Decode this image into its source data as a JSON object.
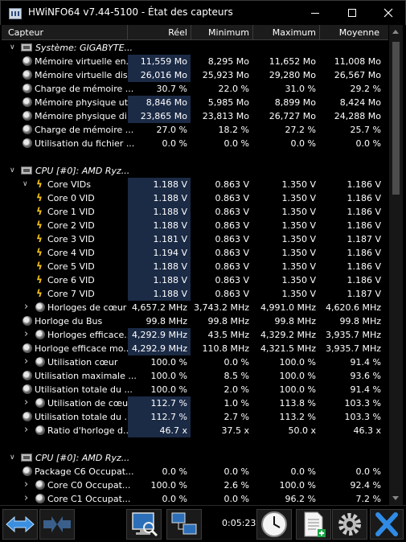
{
  "window": {
    "title": "HWiNFO64 v7.44-5100 - État des capteurs",
    "controls": {
      "minimize": "minimize-icon",
      "maximize": "maximize-icon",
      "close": "close-icon"
    }
  },
  "columns": {
    "sensor": "Capteur",
    "current": "Réel",
    "minimum": "Minimum",
    "maximum": "Maximum",
    "average": "Moyenne"
  },
  "rows": [
    {
      "type": "group",
      "label": "Système: GIGABYTE..."
    },
    {
      "type": "sensor",
      "label": "Mémoire virtuelle en...",
      "cur": "11,559 Mo",
      "min": "8,295 Mo",
      "max": "11,652 Mo",
      "avg": "11,008 Mo",
      "hl": true
    },
    {
      "type": "sensor",
      "label": "Mémoire virtuelle dis...",
      "cur": "26,016 Mo",
      "min": "25,923 Mo",
      "max": "29,280 Mo",
      "avg": "26,567 Mo",
      "hl": true
    },
    {
      "type": "sensor",
      "label": "Charge de mémoire ...",
      "cur": "30.7 %",
      "min": "22.0 %",
      "max": "31.0 %",
      "avg": "29.2 %",
      "hl": false
    },
    {
      "type": "sensor",
      "label": "Mémoire physique ut...",
      "cur": "8,846 Mo",
      "min": "5,985 Mo",
      "max": "8,899 Mo",
      "avg": "8,424 Mo",
      "hl": true
    },
    {
      "type": "sensor",
      "label": "Mémoire physique di...",
      "cur": "23,865 Mo",
      "min": "23,813 Mo",
      "max": "26,727 Mo",
      "avg": "24,288 Mo",
      "hl": true
    },
    {
      "type": "sensor",
      "label": "Charge de mémoire ...",
      "cur": "27.0 %",
      "min": "18.2 %",
      "max": "27.2 %",
      "avg": "25.7 %",
      "hl": false
    },
    {
      "type": "sensor",
      "label": "Utilisation du fichier ...",
      "cur": "0.0 %",
      "min": "0.0 %",
      "max": "0.0 %",
      "avg": "0.0 %",
      "hl": false
    },
    {
      "type": "blank"
    },
    {
      "type": "group",
      "label": "CPU [#0]: AMD Ryz..."
    },
    {
      "type": "volt-parent",
      "label": "Core VIDs",
      "cur": "1.188 V",
      "min": "0.863 V",
      "max": "1.350 V",
      "avg": "1.186 V",
      "hl": true
    },
    {
      "type": "volt",
      "label": "Core 0 VID",
      "cur": "1.188 V",
      "min": "0.863 V",
      "max": "1.350 V",
      "avg": "1.186 V",
      "hl": true
    },
    {
      "type": "volt",
      "label": "Core 1 VID",
      "cur": "1.188 V",
      "min": "0.863 V",
      "max": "1.350 V",
      "avg": "1.186 V",
      "hl": true
    },
    {
      "type": "volt",
      "label": "Core 2 VID",
      "cur": "1.188 V",
      "min": "0.863 V",
      "max": "1.350 V",
      "avg": "1.186 V",
      "hl": true
    },
    {
      "type": "volt",
      "label": "Core 3 VID",
      "cur": "1.181 V",
      "min": "0.863 V",
      "max": "1.350 V",
      "avg": "1.187 V",
      "hl": true
    },
    {
      "type": "volt",
      "label": "Core 4 VID",
      "cur": "1.194 V",
      "min": "0.863 V",
      "max": "1.350 V",
      "avg": "1.186 V",
      "hl": true
    },
    {
      "type": "volt",
      "label": "Core 5 VID",
      "cur": "1.188 V",
      "min": "0.863 V",
      "max": "1.350 V",
      "avg": "1.186 V",
      "hl": true
    },
    {
      "type": "volt",
      "label": "Core 6 VID",
      "cur": "1.188 V",
      "min": "0.863 V",
      "max": "1.350 V",
      "avg": "1.186 V",
      "hl": true
    },
    {
      "type": "volt",
      "label": "Core 7 VID",
      "cur": "1.188 V",
      "min": "0.863 V",
      "max": "1.350 V",
      "avg": "1.187 V",
      "hl": true
    },
    {
      "type": "clock-collapsed",
      "label": "Horloges de cœur",
      "cur": "4,657.2 MHz",
      "min": "3,743.2 MHz",
      "max": "4,991.0 MHz",
      "avg": "4,620.6 MHz",
      "hl": false
    },
    {
      "type": "clock",
      "label": "Horloge du Bus",
      "cur": "99.8 MHz",
      "min": "99.8 MHz",
      "max": "99.8 MHz",
      "avg": "99.8 MHz",
      "hl": false
    },
    {
      "type": "clock-collapsed",
      "label": "Horloges efficace...",
      "cur": "4,292.9 MHz",
      "min": "43.5 MHz",
      "max": "4,329.2 MHz",
      "avg": "3,935.7 MHz",
      "hl": true
    },
    {
      "type": "clock",
      "label": "Horloge efficace mo...",
      "cur": "4,292.9 MHz",
      "min": "110.8 MHz",
      "max": "4,321.5 MHz",
      "avg": "3,935.7 MHz",
      "hl": true
    },
    {
      "type": "sensor-collapsed",
      "label": "Utilisation cœur",
      "cur": "100.0 %",
      "min": "0.0 %",
      "max": "100.0 %",
      "avg": "91.4 %",
      "hl": false
    },
    {
      "type": "sensor",
      "label": "Utilisation maximale ...",
      "cur": "100.0 %",
      "min": "8.5 %",
      "max": "100.0 %",
      "avg": "93.6 %",
      "hl": false
    },
    {
      "type": "sensor",
      "label": "Utilisation totale du ...",
      "cur": "100.0 %",
      "min": "2.0 %",
      "max": "100.0 %",
      "avg": "91.4 %",
      "hl": false
    },
    {
      "type": "sensor-collapsed",
      "label": "Utilisation de cœur",
      "cur": "112.7 %",
      "min": "1.0 %",
      "max": "113.8 %",
      "avg": "103.3 %",
      "hl": true
    },
    {
      "type": "sensor",
      "label": "Utilisation totale du ...",
      "cur": "112.7 %",
      "min": "2.7 %",
      "max": "113.2 %",
      "avg": "103.3 %",
      "hl": true
    },
    {
      "type": "sensor-collapsed",
      "label": "Ratio d'horloge d...",
      "cur": "46.7 x",
      "min": "37.5 x",
      "max": "50.0 x",
      "avg": "46.3 x",
      "hl": true
    },
    {
      "type": "blank"
    },
    {
      "type": "group",
      "label": "CPU [#0]: AMD Ryz..."
    },
    {
      "type": "sensor",
      "label": "Package C6 Occupat...",
      "cur": "0.0 %",
      "min": "0.0 %",
      "max": "0.0 %",
      "avg": "0.0 %",
      "hl": false
    },
    {
      "type": "sensor-collapsed",
      "label": "Core C0 Occupat...",
      "cur": "100.0 %",
      "min": "2.6 %",
      "max": "100.0 %",
      "avg": "92.4 %",
      "hl": false
    },
    {
      "type": "sensor-collapsed",
      "label": "Core C1 Occupat...",
      "cur": "0.0 %",
      "min": "0.0 %",
      "max": "96.2 %",
      "avg": "7.2 %",
      "hl": false
    }
  ],
  "toolbar": {
    "timer": "0:05:23",
    "buttons": [
      {
        "name": "expand-arrows-button",
        "icon": "double-arrow-icon"
      },
      {
        "name": "collapse-arrows-button",
        "icon": "arrows-in-icon"
      },
      {
        "name": "sensor-report-button",
        "icon": "monitor-search-icon"
      },
      {
        "name": "network-button",
        "icon": "network-monitors-icon"
      },
      {
        "name": "clock-button",
        "icon": "clock-icon"
      },
      {
        "name": "logging-button",
        "icon": "document-add-icon"
      },
      {
        "name": "settings-button",
        "icon": "gear-icon"
      },
      {
        "name": "close-button",
        "icon": "close-x-icon"
      }
    ]
  }
}
